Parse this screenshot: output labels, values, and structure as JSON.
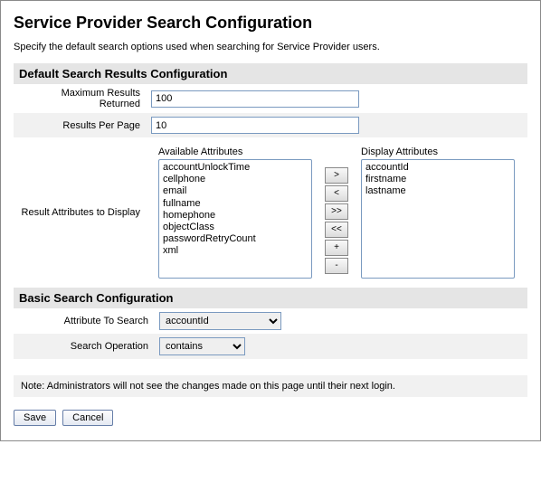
{
  "page": {
    "title": "Service Provider Search Configuration",
    "description": "Specify the default search options used when searching for Service Provider users."
  },
  "section_default": {
    "header": "Default Search Results Configuration",
    "max_results_label": "Maximum Results Returned",
    "max_results_value": "100",
    "per_page_label": "Results Per Page",
    "per_page_value": "10",
    "result_attrs_label": "Result Attributes to Display",
    "available_header": "Available Attributes",
    "display_header": "Display Attributes",
    "available": [
      "accountUnlockTime",
      "cellphone",
      "email",
      "fullname",
      "homephone",
      "objectClass",
      "passwordRetryCount",
      "xml"
    ],
    "display": [
      "accountId",
      "firstname",
      "lastname"
    ],
    "btn_move_right": ">",
    "btn_move_left": "<",
    "btn_move_all_right": ">>",
    "btn_move_all_left": "<<",
    "btn_up": "+",
    "btn_down": "-"
  },
  "section_basic": {
    "header": "Basic Search Configuration",
    "attr_label": "Attribute To Search",
    "attr_value": "accountId",
    "op_label": "Search Operation",
    "op_value": "contains"
  },
  "note": "Note: Administrators will not see the changes made on this page until their next login.",
  "actions": {
    "save": "Save",
    "cancel": "Cancel"
  }
}
